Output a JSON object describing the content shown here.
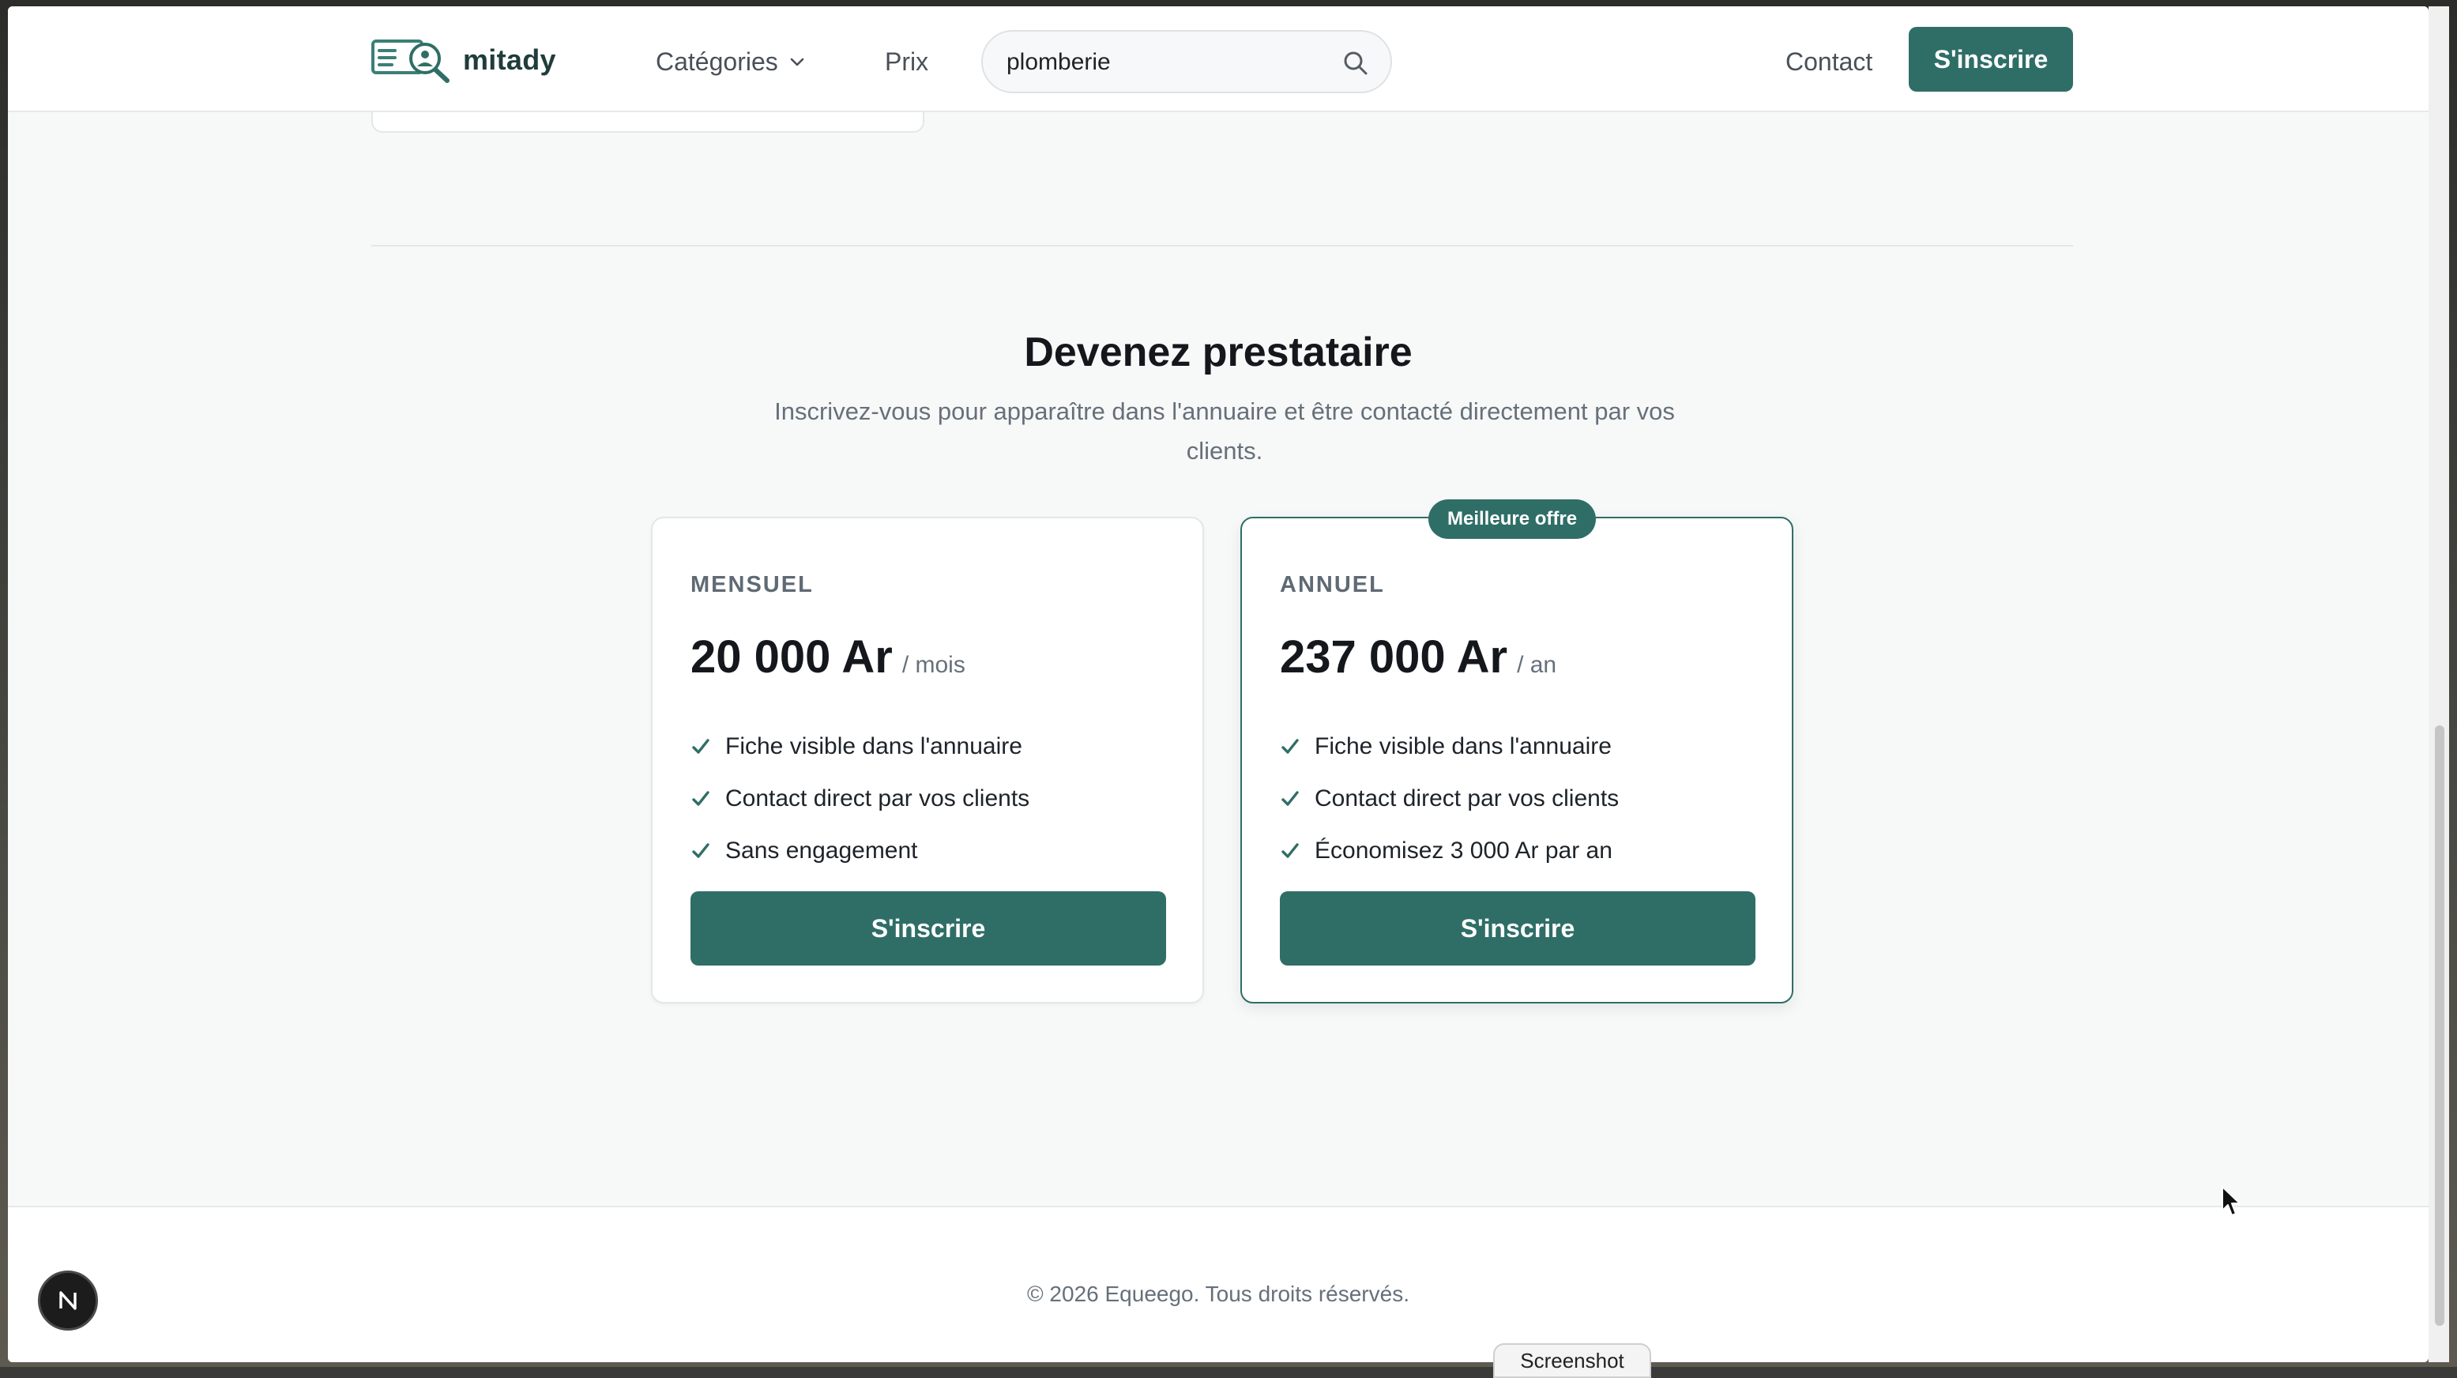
{
  "header": {
    "brand": "mitady",
    "nav_categories": "Catégories",
    "nav_prix": "Prix",
    "search_value": "plomberie",
    "nav_contact": "Contact",
    "signup_label": "S'inscrire"
  },
  "section": {
    "title": "Devenez prestataire",
    "subtitle": "Inscrivez-vous pour apparaître dans l'annuaire et être contacté directement par vos clients."
  },
  "plans": [
    {
      "name": "MENSUEL",
      "price": "20 000 Ar",
      "period": "/ mois",
      "features": [
        "Fiche visible dans l'annuaire",
        "Contact direct par vos clients",
        "Sans engagement"
      ],
      "button": "S'inscrire"
    },
    {
      "name": "ANNUEL",
      "badge": "Meilleure offre",
      "price": "237 000 Ar",
      "period": "/ an",
      "features": [
        "Fiche visible dans l'annuaire",
        "Contact direct par vos clients",
        "Économisez 3 000 Ar par an"
      ],
      "button": "S'inscrire"
    }
  ],
  "footer": {
    "copyright": "© 2026 Equeego. Tous droits réservés."
  },
  "overlay": {
    "screenshot_tab": "Screenshot",
    "dev_badge": "N"
  },
  "colors": {
    "accent": "#2f6e67",
    "text_dark": "#14181c",
    "text_muted": "#66707a",
    "background": "#f7f8f8"
  },
  "icons": [
    "logo-icon",
    "chevron-down-icon",
    "search-icon",
    "check-icon",
    "next-dev-icon",
    "mouse-cursor-icon"
  ]
}
